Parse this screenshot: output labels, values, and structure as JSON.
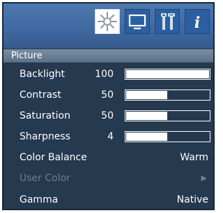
{
  "tabs": [
    {
      "name": "brightness-icon",
      "active": true
    },
    {
      "name": "monitor-icon",
      "active": false
    },
    {
      "name": "tools-icon",
      "active": false
    },
    {
      "name": "info-icon",
      "active": false
    }
  ],
  "section": {
    "title": "Picture"
  },
  "rows": [
    {
      "label": "Backlight",
      "value": "100",
      "level": 1.0
    },
    {
      "label": "Contrast",
      "value": "50",
      "level": 0.5
    },
    {
      "label": "Saturation",
      "value": "50",
      "level": 0.5
    },
    {
      "label": "Sharpness",
      "value": "4",
      "level": 0.5
    },
    {
      "label": "Color Balance",
      "value": "Warm"
    },
    {
      "label": "User Color",
      "value": "▶",
      "disabled": true
    },
    {
      "label": "Gamma",
      "value": "Native"
    }
  ],
  "info_glyph": "i",
  "colors": {
    "panel": "#25394f",
    "header": "#3f68a0",
    "section_bar": "#6b7f96",
    "text": "#ffffff",
    "disabled_text": "#6f7e8e"
  }
}
